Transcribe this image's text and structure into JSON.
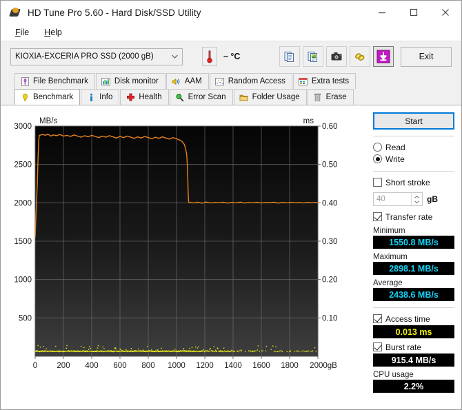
{
  "window": {
    "title": "HD Tune Pro 5.60 - Hard Disk/SSD Utility",
    "minimize_label": "Minimize",
    "maximize_label": "Maximize",
    "close_label": "Close"
  },
  "menu": {
    "items": [
      "File",
      "Help"
    ]
  },
  "toolbar": {
    "drive": "KIOXIA-EXCERIA PRO SSD (2000 gB)",
    "temperature": "– °C",
    "buttons": [
      {
        "name": "copy-text-icon"
      },
      {
        "name": "copy-image-icon"
      },
      {
        "name": "screenshot-icon"
      },
      {
        "name": "folder-link-icon"
      },
      {
        "name": "download-arrow-icon"
      }
    ],
    "exit_label": "Exit"
  },
  "tabs": {
    "top_row": [
      {
        "label": "File Benchmark",
        "icon": "file-benchmark-icon"
      },
      {
        "label": "Disk monitor",
        "icon": "disk-monitor-icon"
      },
      {
        "label": "AAM",
        "icon": "aam-speaker-icon"
      },
      {
        "label": "Random Access",
        "icon": "random-access-icon"
      },
      {
        "label": "Extra tests",
        "icon": "extra-tests-icon"
      }
    ],
    "bottom_row": [
      {
        "label": "Benchmark",
        "icon": "benchmark-bulb-icon",
        "active": true
      },
      {
        "label": "Info",
        "icon": "info-icon",
        "active": false
      },
      {
        "label": "Health",
        "icon": "health-cross-icon",
        "active": false
      },
      {
        "label": "Error Scan",
        "icon": "error-scan-magnifier-icon",
        "active": false
      },
      {
        "label": "Folder Usage",
        "icon": "folder-usage-icon",
        "active": false
      },
      {
        "label": "Erase",
        "icon": "erase-trash-icon",
        "active": false
      }
    ]
  },
  "side_panel": {
    "start_label": "Start",
    "mode": {
      "read_label": "Read",
      "write_label": "Write",
      "selected": "Write"
    },
    "short_stroke": {
      "label": "Short stroke",
      "checked": false,
      "value": "40",
      "unit": "gB"
    },
    "transfer_rate": {
      "label": "Transfer rate",
      "checked": true
    },
    "minimum": {
      "label": "Minimum",
      "value": "1550.8 MB/s"
    },
    "maximum": {
      "label": "Maximum",
      "value": "2898.1 MB/s"
    },
    "average": {
      "label": "Average",
      "value": "2438.6 MB/s"
    },
    "access_time": {
      "label": "Access time",
      "checked": true,
      "value": "0.013 ms"
    },
    "burst_rate": {
      "label": "Burst rate",
      "checked": true,
      "value": "915.4 MB/s"
    },
    "cpu_usage": {
      "label": "CPU usage",
      "value": "2.2%"
    }
  },
  "chart_data": {
    "type": "line",
    "title": "",
    "xlabel": "2000gB",
    "ylabel": "MB/s",
    "y2label": "ms",
    "xlim": [
      0,
      2000
    ],
    "ylim": [
      0,
      3000
    ],
    "y2lim": [
      0,
      0.6
    ],
    "grid": true,
    "legend": "none",
    "xticks": [
      0,
      200,
      400,
      600,
      800,
      1000,
      1200,
      1400,
      1600,
      1800,
      2000
    ],
    "xticklabels": [
      "0",
      "200",
      "400",
      "600",
      "800",
      "1000",
      "1200",
      "1400",
      "1600",
      "1800",
      "2000gB"
    ],
    "yticks": [
      500,
      1000,
      1500,
      2000,
      2500,
      3000
    ],
    "yticklabels": [
      "500",
      "1000",
      "1500",
      "2000",
      "2500",
      "3000"
    ],
    "y2ticks": [
      0.1,
      0.2,
      0.3,
      0.4,
      0.5,
      0.6
    ],
    "y2ticklabels": [
      "0.10",
      "0.20",
      "0.30",
      "0.40",
      "0.50",
      "0.60"
    ],
    "series": [
      {
        "name": "Write transfer rate",
        "color": "#e8821e",
        "axis": "left",
        "x": [
          0,
          5,
          10,
          15,
          20,
          25,
          30,
          40,
          55,
          70,
          90,
          110,
          130,
          150,
          175,
          200,
          225,
          250,
          275,
          300,
          325,
          350,
          375,
          400,
          425,
          450,
          475,
          500,
          525,
          550,
          575,
          600,
          625,
          650,
          675,
          700,
          725,
          750,
          775,
          800,
          825,
          850,
          875,
          900,
          925,
          950,
          975,
          1000,
          1020,
          1040,
          1055,
          1065,
          1072,
          1076,
          1080,
          1082,
          1084,
          1086,
          1090,
          1100,
          1120,
          1150,
          1180,
          1210,
          1240,
          1270,
          1300,
          1330,
          1360,
          1390,
          1420,
          1450,
          1480,
          1510,
          1540,
          1570,
          1600,
          1630,
          1660,
          1690,
          1720,
          1750,
          1780,
          1810,
          1840,
          1870,
          1900,
          1930,
          1960,
          1985,
          2000
        ],
        "y": [
          1550,
          1790,
          2030,
          2240,
          2560,
          2810,
          2880,
          2885,
          2890,
          2880,
          2895,
          2870,
          2885,
          2875,
          2890,
          2870,
          2880,
          2865,
          2885,
          2870,
          2855,
          2875,
          2860,
          2880,
          2865,
          2850,
          2870,
          2855,
          2875,
          2860,
          2845,
          2865,
          2850,
          2870,
          2855,
          2840,
          2860,
          2845,
          2865,
          2850,
          2835,
          2855,
          2840,
          2860,
          2845,
          2830,
          2850,
          2835,
          2820,
          2800,
          2760,
          2700,
          2620,
          2500,
          2300,
          2150,
          2060,
          2010,
          2000,
          2005,
          1998,
          2008,
          1995,
          2010,
          1998,
          2005,
          2000,
          2008,
          1996,
          2006,
          1999,
          2009,
          1997,
          2004,
          2000,
          2007,
          1998,
          2005,
          2001,
          2008,
          1996,
          2006,
          1999,
          2007,
          2000,
          2004,
          1998,
          2006,
          2000,
          2003,
          2000
        ]
      },
      {
        "name": "Access time",
        "color": "#e8e81a",
        "axis": "right",
        "scatter": true,
        "x_range": [
          0,
          2000
        ],
        "y_baseline": 0.013,
        "note": "dense dotted baseline across full span with minor spikes"
      }
    ]
  }
}
